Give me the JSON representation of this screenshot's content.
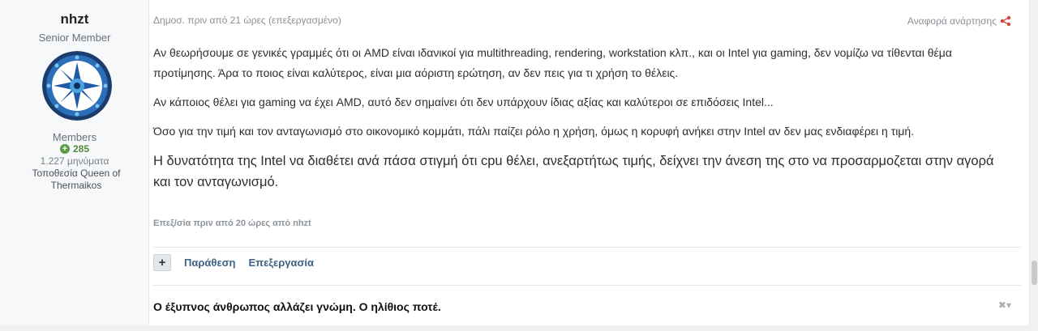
{
  "author": {
    "name": "nhzt",
    "title": "Senior Member",
    "group": "Members",
    "reputation": "285",
    "post_count": "1.227 μηνύματα",
    "location": "Τοποθεσία Queen of Thermaikos"
  },
  "post": {
    "meta": "Δημοσ. πριν από 21 ώρες (επεξεργασμένο)",
    "report": "Αναφορά ανάρτησης",
    "paragraphs": [
      "Αν θεωρήσουμε σε γενικές γραμμές ότι οι AMD είναι ιδανικοί για multithreading, rendering, workstation κλπ., και οι Intel για gaming, δεν νομίζω να τίθενται θέμα προτίμησης. Άρα το ποιος είναι καλύτερος, είναι μια αόριστη ερώτηση, αν δεν πεις για τι χρήση το θέλεις.",
      "Αν κάποιος θέλει για gaming να έχει AMD, αυτό δεν σημαίνει ότι δεν υπάρχουν ίδιας αξίας και καλύτεροι σε επιδόσεις Intel...",
      "Όσο για την τιμή και τον ανταγωνισμό στο οικονομικό κομμάτι, πάλι παίζει ρόλο η χρήση, όμως η κορυφή ανήκει στην Intel αν δεν μας ενδιαφέρει η τιμή.",
      "Η δυνατότητα της Intel να διαθέτει ανά πάσα στιγμή ότι cpu θέλει, ανεξαρτήτως τιμής, δείχνει την άνεση της στο να προσαρμοζεται στην αγορά και τον ανταγωνισμό."
    ],
    "edited": "Επεξ/σία πριν από 20 ώρες από nhzt",
    "controls": {
      "plus": "+",
      "quote": "Παράθεση",
      "edit": "Επεξεργασία"
    },
    "signature": "Ο έξυπνος άνθρωπος αλλάζει γνώμη. Ο ηλίθιος ποτέ.",
    "signature_control": "✖▾"
  },
  "colors": {
    "reputation": "#4f8a3c",
    "link": "#3f6184"
  },
  "icons": [
    "share-icon",
    "reputation-plus-icon",
    "close-icon",
    "chevron-down-icon"
  ]
}
